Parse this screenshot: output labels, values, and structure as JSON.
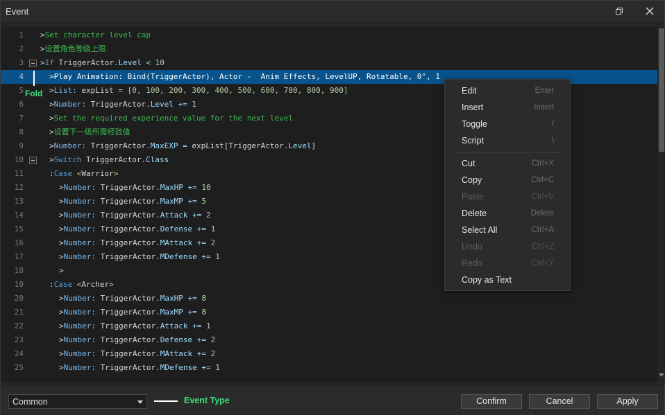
{
  "window": {
    "title": "Event"
  },
  "editor": {
    "selected_line": 4,
    "lines": [
      {
        "n": "1",
        "indent": 0,
        "fold": false,
        "tokens": [
          [
            ">",
            "c-arrow"
          ],
          [
            "Set character level cap",
            "c-green"
          ]
        ]
      },
      {
        "n": "2",
        "indent": 0,
        "fold": false,
        "tokens": [
          [
            ">",
            "c-arrow"
          ],
          [
            "设置角色等级上限",
            "c-green"
          ]
        ]
      },
      {
        "n": "3",
        "indent": 0,
        "fold": true,
        "tokens": [
          [
            ">",
            "c-arrow"
          ],
          [
            "If ",
            "c-blue"
          ],
          [
            "TriggerActor",
            "c-white"
          ],
          [
            ".Level",
            "c-op"
          ],
          [
            " < ",
            "c-op"
          ],
          [
            "10",
            "c-num"
          ]
        ]
      },
      {
        "n": "4",
        "indent": 1,
        "fold": false,
        "tokens": [
          [
            ">",
            "c-arrow"
          ],
          [
            "Play Animation: Bind(TriggerActor), Actor -  Anim Effects, LevelUP, Rotatable, 0°, 1",
            "c-white"
          ]
        ]
      },
      {
        "n": "5",
        "indent": 1,
        "fold": false,
        "tokens": [
          [
            ">",
            "c-arrow"
          ],
          [
            "List: ",
            "c-kw"
          ],
          [
            "expList",
            "c-white"
          ],
          [
            " = ",
            "c-op"
          ],
          [
            "[0, 100, 200, 300, 400, 500, 600, 700, 800, 900]",
            "c-num"
          ]
        ]
      },
      {
        "n": "6",
        "indent": 1,
        "fold": false,
        "tokens": [
          [
            ">",
            "c-arrow"
          ],
          [
            "Number: ",
            "c-kw"
          ],
          [
            "TriggerActor",
            "c-white"
          ],
          [
            ".Level",
            "c-op"
          ],
          [
            " += ",
            "c-op"
          ],
          [
            "1",
            "c-num"
          ]
        ]
      },
      {
        "n": "7",
        "indent": 1,
        "fold": false,
        "tokens": [
          [
            ">",
            "c-arrow"
          ],
          [
            "Set the required experience value for the next level",
            "c-green"
          ]
        ]
      },
      {
        "n": "8",
        "indent": 1,
        "fold": false,
        "tokens": [
          [
            ">",
            "c-arrow"
          ],
          [
            "设置下一级所需经验值",
            "c-green"
          ]
        ]
      },
      {
        "n": "9",
        "indent": 1,
        "fold": false,
        "tokens": [
          [
            ">",
            "c-arrow"
          ],
          [
            "Number: ",
            "c-kw"
          ],
          [
            "TriggerActor",
            "c-white"
          ],
          [
            ".MaxEXP",
            "c-op"
          ],
          [
            " = ",
            "c-op"
          ],
          [
            "expList",
            "c-white"
          ],
          [
            "[",
            "c-white"
          ],
          [
            "TriggerActor",
            "c-white"
          ],
          [
            ".Level",
            "c-op"
          ],
          [
            "]",
            "c-white"
          ]
        ]
      },
      {
        "n": "10",
        "indent": 1,
        "fold": true,
        "tokens": [
          [
            ">",
            "c-arrow"
          ],
          [
            "Switch ",
            "c-blue"
          ],
          [
            "TriggerActor",
            "c-white"
          ],
          [
            ".Class",
            "c-op"
          ]
        ]
      },
      {
        "n": "11",
        "indent": 1,
        "fold": false,
        "tokens": [
          [
            ":",
            "c-arrow"
          ],
          [
            "Case ",
            "c-blue"
          ],
          [
            "<",
            "c-yel"
          ],
          [
            "Warrior",
            "c-white"
          ],
          [
            ">",
            "c-yel"
          ]
        ]
      },
      {
        "n": "12",
        "indent": 2,
        "fold": false,
        "tokens": [
          [
            ">",
            "c-arrow"
          ],
          [
            "Number: ",
            "c-kw"
          ],
          [
            "TriggerActor",
            "c-white"
          ],
          [
            ".MaxHP",
            "c-op"
          ],
          [
            " += ",
            "c-op"
          ],
          [
            "10",
            "c-num"
          ]
        ]
      },
      {
        "n": "13",
        "indent": 2,
        "fold": false,
        "tokens": [
          [
            ">",
            "c-arrow"
          ],
          [
            "Number: ",
            "c-kw"
          ],
          [
            "TriggerActor",
            "c-white"
          ],
          [
            ".MaxMP",
            "c-op"
          ],
          [
            " += ",
            "c-op"
          ],
          [
            "5",
            "c-num"
          ]
        ]
      },
      {
        "n": "14",
        "indent": 2,
        "fold": false,
        "tokens": [
          [
            ">",
            "c-arrow"
          ],
          [
            "Number: ",
            "c-kw"
          ],
          [
            "TriggerActor",
            "c-white"
          ],
          [
            ".Attack",
            "c-op"
          ],
          [
            " += ",
            "c-op"
          ],
          [
            "2",
            "c-num"
          ]
        ]
      },
      {
        "n": "15",
        "indent": 2,
        "fold": false,
        "tokens": [
          [
            ">",
            "c-arrow"
          ],
          [
            "Number: ",
            "c-kw"
          ],
          [
            "TriggerActor",
            "c-white"
          ],
          [
            ".Defense",
            "c-op"
          ],
          [
            " += ",
            "c-op"
          ],
          [
            "1",
            "c-num"
          ]
        ]
      },
      {
        "n": "16",
        "indent": 2,
        "fold": false,
        "tokens": [
          [
            ">",
            "c-arrow"
          ],
          [
            "Number: ",
            "c-kw"
          ],
          [
            "TriggerActor",
            "c-white"
          ],
          [
            ".MAttack",
            "c-op"
          ],
          [
            " += ",
            "c-op"
          ],
          [
            "2",
            "c-num"
          ]
        ]
      },
      {
        "n": "17",
        "indent": 2,
        "fold": false,
        "tokens": [
          [
            ">",
            "c-arrow"
          ],
          [
            "Number: ",
            "c-kw"
          ],
          [
            "TriggerActor",
            "c-white"
          ],
          [
            ".MDefense",
            "c-op"
          ],
          [
            " += ",
            "c-op"
          ],
          [
            "1",
            "c-num"
          ]
        ]
      },
      {
        "n": "18",
        "indent": 2,
        "fold": false,
        "tokens": [
          [
            ">",
            "c-arrow"
          ]
        ]
      },
      {
        "n": "19",
        "indent": 1,
        "fold": false,
        "tokens": [
          [
            ":",
            "c-arrow"
          ],
          [
            "Case ",
            "c-blue"
          ],
          [
            "<",
            "c-yel"
          ],
          [
            "Archer",
            "c-white"
          ],
          [
            ">",
            "c-yel"
          ]
        ]
      },
      {
        "n": "20",
        "indent": 2,
        "fold": false,
        "tokens": [
          [
            ">",
            "c-arrow"
          ],
          [
            "Number: ",
            "c-kw"
          ],
          [
            "TriggerActor",
            "c-white"
          ],
          [
            ".MaxHP",
            "c-op"
          ],
          [
            " += ",
            "c-op"
          ],
          [
            "8",
            "c-num"
          ]
        ]
      },
      {
        "n": "21",
        "indent": 2,
        "fold": false,
        "tokens": [
          [
            ">",
            "c-arrow"
          ],
          [
            "Number: ",
            "c-kw"
          ],
          [
            "TriggerActor",
            "c-white"
          ],
          [
            ".MaxMP",
            "c-op"
          ],
          [
            " += ",
            "c-op"
          ],
          [
            "8",
            "c-num"
          ]
        ]
      },
      {
        "n": "22",
        "indent": 2,
        "fold": false,
        "tokens": [
          [
            ">",
            "c-arrow"
          ],
          [
            "Number: ",
            "c-kw"
          ],
          [
            "TriggerActor",
            "c-white"
          ],
          [
            ".Attack",
            "c-op"
          ],
          [
            " += ",
            "c-op"
          ],
          [
            "1",
            "c-num"
          ]
        ]
      },
      {
        "n": "23",
        "indent": 2,
        "fold": false,
        "tokens": [
          [
            ">",
            "c-arrow"
          ],
          [
            "Number: ",
            "c-kw"
          ],
          [
            "TriggerActor",
            "c-white"
          ],
          [
            ".Defense",
            "c-op"
          ],
          [
            " += ",
            "c-op"
          ],
          [
            "2",
            "c-num"
          ]
        ]
      },
      {
        "n": "24",
        "indent": 2,
        "fold": false,
        "tokens": [
          [
            ">",
            "c-arrow"
          ],
          [
            "Number: ",
            "c-kw"
          ],
          [
            "TriggerActor",
            "c-white"
          ],
          [
            ".MAttack",
            "c-op"
          ],
          [
            " += ",
            "c-op"
          ],
          [
            "2",
            "c-num"
          ]
        ]
      },
      {
        "n": "25",
        "indent": 2,
        "fold": false,
        "tokens": [
          [
            ">",
            "c-arrow"
          ],
          [
            "Number: ",
            "c-kw"
          ],
          [
            "TriggerActor",
            "c-white"
          ],
          [
            ".MDefense",
            "c-op"
          ],
          [
            " += ",
            "c-op"
          ],
          [
            "1",
            "c-num"
          ]
        ]
      }
    ]
  },
  "annotations": {
    "fold_label": "Fold",
    "event_type_label": "Event Type"
  },
  "context_menu": {
    "items": [
      {
        "label": "Edit",
        "shortcut": "Enter",
        "enabled": true
      },
      {
        "label": "Insert",
        "shortcut": "Insert",
        "enabled": true
      },
      {
        "label": "Toggle",
        "shortcut": "/",
        "enabled": true
      },
      {
        "label": "Script",
        "shortcut": "\\",
        "enabled": true
      },
      {
        "label": "Cut",
        "shortcut": "Ctrl+X",
        "enabled": true
      },
      {
        "label": "Copy",
        "shortcut": "Ctrl+C",
        "enabled": true
      },
      {
        "label": "Paste",
        "shortcut": "Ctrl+V",
        "enabled": false
      },
      {
        "label": "Delete",
        "shortcut": "Delete",
        "enabled": true
      },
      {
        "label": "Select All",
        "shortcut": "Ctrl+A",
        "enabled": true
      },
      {
        "label": "Undo",
        "shortcut": "Ctrl+Z",
        "enabled": false
      },
      {
        "label": "Redo",
        "shortcut": "Ctrl+Y",
        "enabled": false
      },
      {
        "label": "Copy as Text",
        "shortcut": "",
        "enabled": true
      }
    ]
  },
  "footer": {
    "event_type_value": "Common",
    "confirm_label": "Confirm",
    "cancel_label": "Cancel",
    "apply_label": "Apply"
  },
  "colors": {
    "selection": "#08538c",
    "comment_green": "#3fb950",
    "annotation_green": "#3fe07a"
  }
}
